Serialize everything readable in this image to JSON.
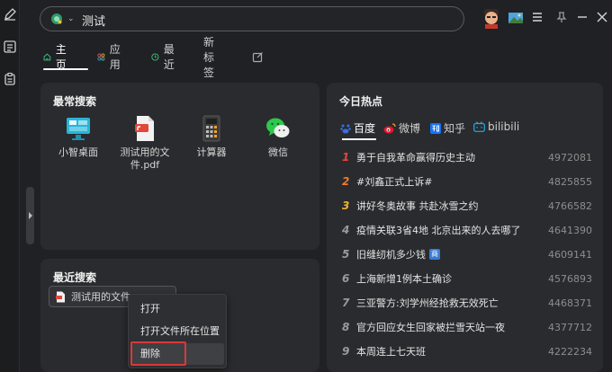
{
  "search": {
    "query": "测试"
  },
  "tabs": [
    {
      "label": "主页",
      "icon": "home-icon",
      "active": true
    },
    {
      "label": "应用",
      "icon": "apps-icon"
    },
    {
      "label": "最近",
      "icon": "clock-icon"
    },
    {
      "label": "新标签"
    },
    {
      "label": "",
      "icon": "edit-tab-icon"
    }
  ],
  "frequent": {
    "title": "最常搜索",
    "apps": [
      {
        "label": "小智桌面",
        "icon": "desktop-icon"
      },
      {
        "label": "测试用的文件.pdf",
        "icon": "pdf-file-icon"
      },
      {
        "label": "计算器",
        "icon": "calculator-icon"
      },
      {
        "label": "微信",
        "icon": "wechat-icon"
      }
    ]
  },
  "recent": {
    "title": "最近搜索",
    "chip_label": "测试用的文件..."
  },
  "context_menu": {
    "items": [
      "打开",
      "打开文件所在位置",
      "删除"
    ]
  },
  "hot": {
    "title": "今日热点",
    "sources": [
      {
        "label": "百度",
        "icon": "baidu-icon",
        "active": true
      },
      {
        "label": "微博",
        "icon": "weibo-icon"
      },
      {
        "label": "知乎",
        "icon": "zhihu-icon"
      },
      {
        "label": "bilibili",
        "icon": "bilibili-icon"
      }
    ],
    "items": [
      {
        "rank": "1",
        "title": "勇于自我革命赢得历史主动",
        "count": "4972081",
        "color": "#e8453c"
      },
      {
        "rank": "2",
        "title": "#刘鑫正式上诉#",
        "count": "4825855",
        "color": "#f07b2a"
      },
      {
        "rank": "3",
        "title": "讲好冬奥故事 共赴冰雪之约",
        "count": "4766582",
        "color": "#f2b134"
      },
      {
        "rank": "4",
        "title": "疫情关联3省4地 北京出来的人去哪了",
        "count": "4641390",
        "color": "#9a9a9a"
      },
      {
        "rank": "5",
        "title": "旧缝纫机多少钱",
        "count": "4609141",
        "color": "#9a9a9a",
        "badge": "商"
      },
      {
        "rank": "6",
        "title": "上海新增1例本土确诊",
        "count": "4576893",
        "color": "#9a9a9a"
      },
      {
        "rank": "7",
        "title": "三亚警方:刘学州经抢救无效死亡",
        "count": "4468371",
        "color": "#9a9a9a"
      },
      {
        "rank": "8",
        "title": "官方回应女生回家被拦雪天站一夜",
        "count": "4377712",
        "color": "#9a9a9a"
      },
      {
        "rank": "9",
        "title": "本周连上七天班",
        "count": "4222234",
        "color": "#9a9a9a"
      }
    ]
  }
}
